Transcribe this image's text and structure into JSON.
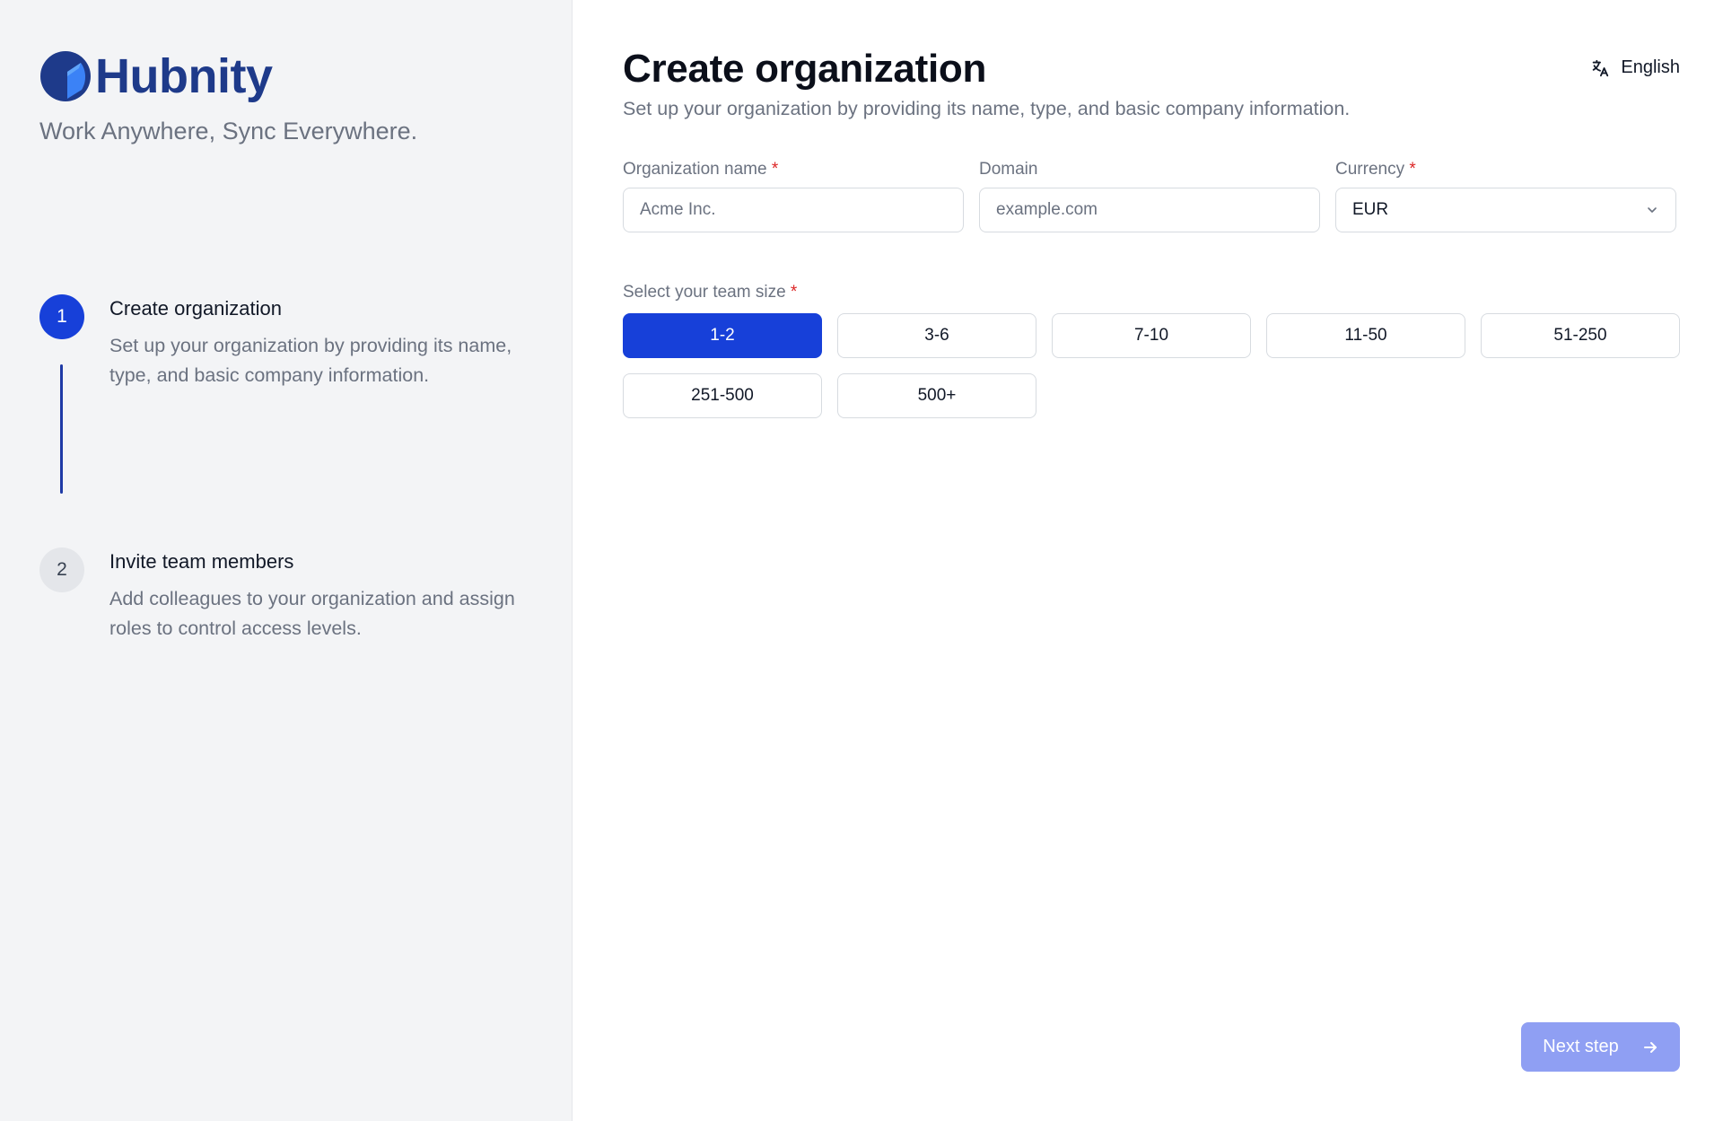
{
  "sidebar": {
    "brand_name": "Hubnity",
    "tagline": "Work Anywhere, Sync Everywhere.",
    "steps": [
      {
        "number": "1",
        "title": "Create organization",
        "description": "Set up your organization by providing its name, type, and basic company information.",
        "active": true
      },
      {
        "number": "2",
        "title": "Invite team members",
        "description": "Add colleagues to your organization and assign roles to control access levels.",
        "active": false
      }
    ]
  },
  "header": {
    "title": "Create organization",
    "subtitle": "Set up your organization by providing its name, type, and basic company information.",
    "language": "English",
    "language_icon": "translate-icon"
  },
  "form": {
    "org_name": {
      "label": "Organization name",
      "required_mark": "*",
      "value": "",
      "placeholder": "Acme Inc."
    },
    "domain": {
      "label": "Domain",
      "value": "",
      "placeholder": "example.com"
    },
    "currency": {
      "label": "Currency",
      "required_mark": "*",
      "value": "EUR",
      "icon": "chevron-down-icon"
    },
    "team_size": {
      "label": "Select your team size",
      "required_mark": "*",
      "selected": "1-2",
      "options": [
        "1-2",
        "3-6",
        "7-10",
        "11-50",
        "51-250",
        "251-500",
        "500+"
      ]
    }
  },
  "footer": {
    "next_label": "Next step",
    "next_icon": "arrow-right-icon"
  },
  "colors": {
    "accent": "#1740d9",
    "brand": "#1e3a8a",
    "required": "#dc2626",
    "next_button_disabled": "#8f9ff3"
  }
}
